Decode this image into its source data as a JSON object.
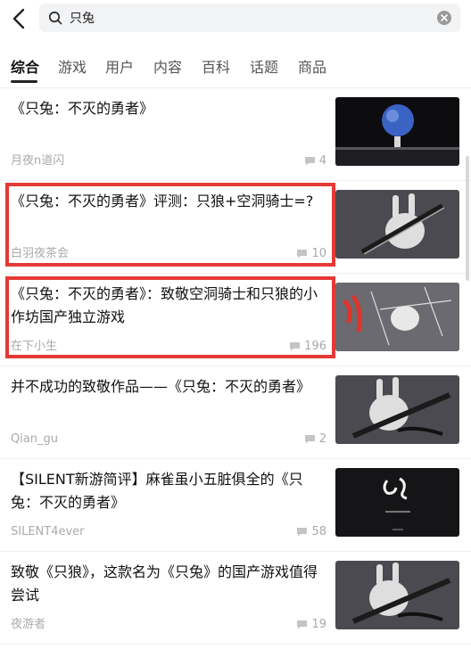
{
  "search": {
    "value": "只兔"
  },
  "tabs": [
    {
      "label": "综合"
    },
    {
      "label": "游戏"
    },
    {
      "label": "用户"
    },
    {
      "label": "内容"
    },
    {
      "label": "百科"
    },
    {
      "label": "话题"
    },
    {
      "label": "商品"
    }
  ],
  "results": [
    {
      "title": "《只兔：不灭的勇者》",
      "author": "月夜n道闪",
      "comments": "4",
      "thumb": "planet-scene"
    },
    {
      "title": "《只兔：不灭的勇者》评测：只狼+空洞骑士=?",
      "author": "白羽夜茶会",
      "comments": "10",
      "thumb": "rabbit-blade"
    },
    {
      "title": "《只兔：不灭的勇者》：致敬空洞骑士和只狼的小作坊国产独立游戏",
      "author": "在下小生",
      "comments": "196",
      "thumb": "comic-sketch"
    },
    {
      "title": "并不成功的致敬作品——《只兔：不灭的勇者》",
      "author": "Qian_gu",
      "comments": "2",
      "thumb": "rabbit-blade"
    },
    {
      "title": "【SILENT新游简评】麻雀虽小五脏俱全的《只兔：不灭的勇者》",
      "author": "SILENT4ever",
      "comments": "58",
      "thumb": "dark-title"
    },
    {
      "title": "致敬《只狼》，这款名为《只兔》的国产游戏值得尝试",
      "author": "夜游者",
      "comments": "19",
      "thumb": "rabbit-blade"
    }
  ],
  "colors": {
    "highlight": "#e53935",
    "tab_active": "#111111",
    "muted": "#aaaaaa"
  }
}
